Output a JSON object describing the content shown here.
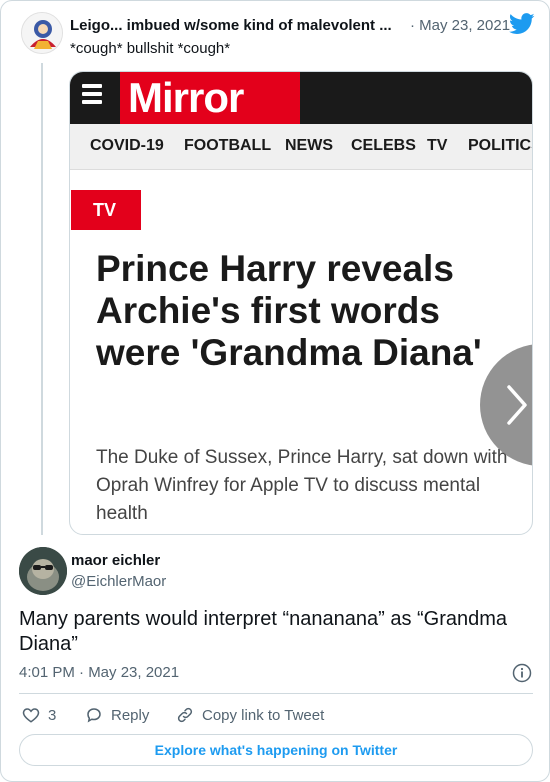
{
  "quoted_tweet": {
    "author_name": "Leigo... imbued w/some kind of malevolent ...",
    "date": "· May 23, 2021",
    "text": "*cough* bullshit *cough*"
  },
  "embedded_article": {
    "site_logo": "Mirror",
    "nav_items": [
      "COVID-19",
      "FOOTBALL",
      "NEWS",
      "CELEBS",
      "TV",
      "POLITICS"
    ],
    "section_badge": "TV",
    "headline": "Prince Harry reveals Archie's first words were 'Grandma Diana'",
    "standfirst": "The Duke of Sussex, Prince Harry, sat down with Oprah Winfrey for Apple TV to discuss mental health"
  },
  "tweet": {
    "author_name": "maor eichler",
    "handle": "@EichlerMaor",
    "text": "Many parents would interpret “nananana” as “Grandma Diana”",
    "timestamp": "4:01 PM · May 23, 2021"
  },
  "actions": {
    "like_count": "3",
    "reply_label": "Reply",
    "copy_link_label": "Copy link to Tweet"
  },
  "explore_label": "Explore what's happening on Twitter",
  "colors": {
    "twitter_blue": "#1d9bf0",
    "mirror_red": "#e3001b",
    "secondary_text": "#536471"
  },
  "icons": [
    "twitter-bird-icon",
    "hamburger-menu-icon",
    "chevron-right-icon",
    "info-icon",
    "heart-icon",
    "reply-bubble-icon",
    "link-icon"
  ]
}
